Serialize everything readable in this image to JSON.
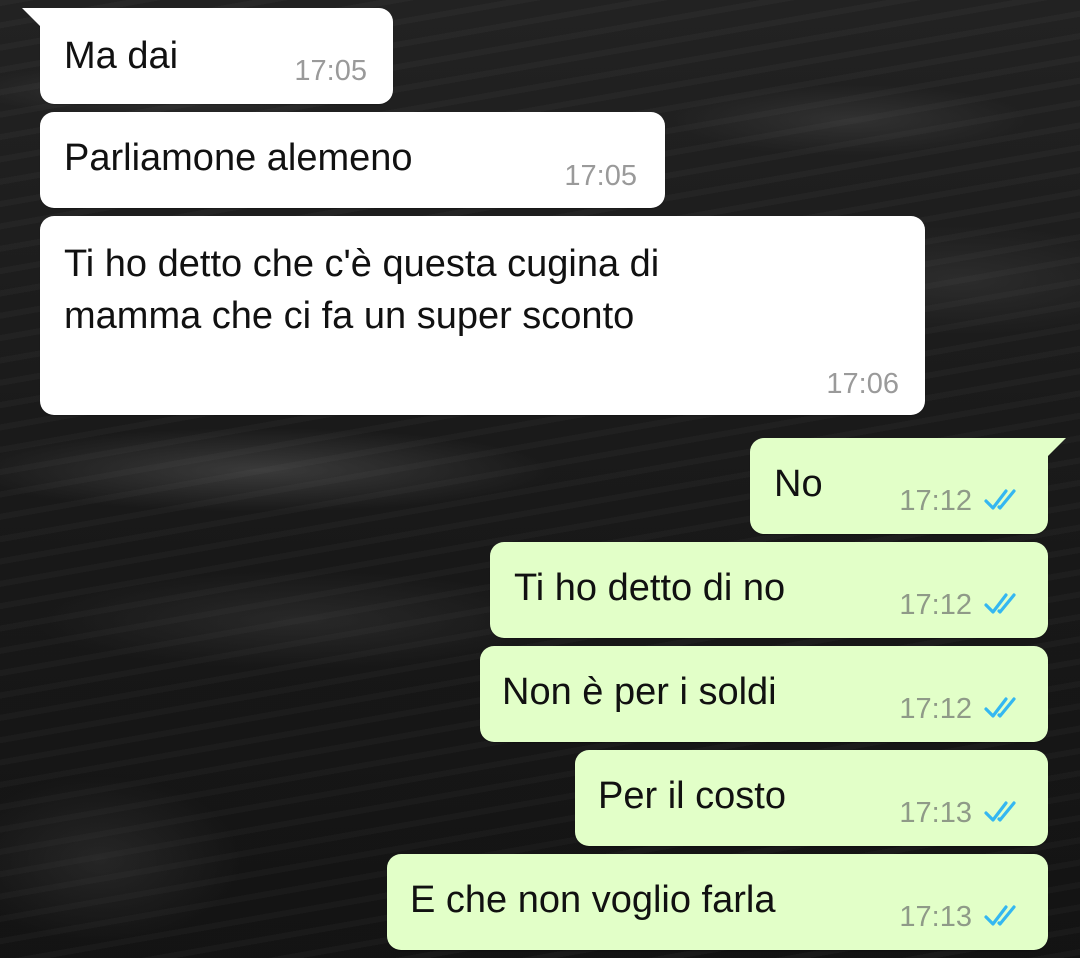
{
  "colors": {
    "incoming_bubble": "#ffffff",
    "outgoing_bubble": "#e2ffc8",
    "read_ticks": "#34b7f1"
  },
  "messages": [
    {
      "direction": "incoming",
      "text": "Ma dai",
      "time": "17:05"
    },
    {
      "direction": "incoming",
      "text": "Parliamone alemeno",
      "time": "17:05"
    },
    {
      "direction": "incoming",
      "text": "Ti ho detto che c'è questa cugina di\nmamma che ci fa un super sconto",
      "time": "17:06"
    },
    {
      "direction": "outgoing",
      "text": "No",
      "time": "17:12",
      "status_icon": "double-check-read-icon"
    },
    {
      "direction": "outgoing",
      "text": "Ti ho detto di no",
      "time": "17:12",
      "status_icon": "double-check-read-icon"
    },
    {
      "direction": "outgoing",
      "text": "Non è per i soldi",
      "time": "17:12",
      "status_icon": "double-check-read-icon"
    },
    {
      "direction": "outgoing",
      "text": "Per il costo",
      "time": "17:13",
      "status_icon": "double-check-read-icon"
    },
    {
      "direction": "outgoing",
      "text": "E che non voglio farla",
      "time": "17:13",
      "status_icon": "double-check-read-icon"
    }
  ]
}
